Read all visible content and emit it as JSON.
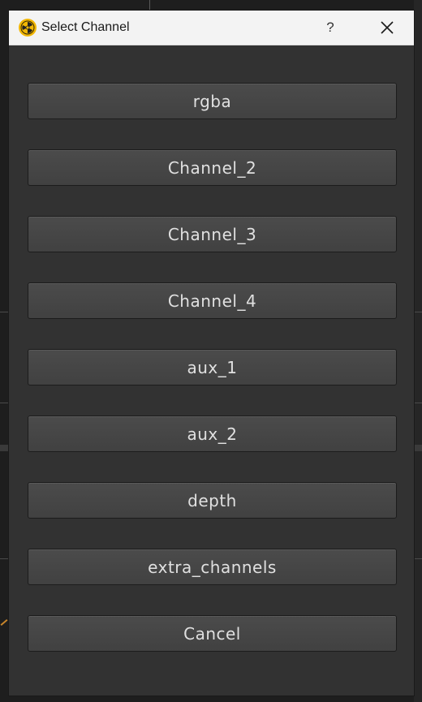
{
  "window": {
    "title": "Select Channel",
    "help_label": "?",
    "close_icon": "close-icon",
    "app_icon": "nuke-app-icon"
  },
  "buttons": [
    {
      "label": "rgba"
    },
    {
      "label": "Channel_2"
    },
    {
      "label": "Channel_3"
    },
    {
      "label": "Channel_4"
    },
    {
      "label": "aux_1"
    },
    {
      "label": "aux_2"
    },
    {
      "label": "depth"
    },
    {
      "label": "extra_channels"
    },
    {
      "label": "Cancel"
    }
  ],
  "colors": {
    "dialog_bg": "#323232",
    "button_bg": "#464646",
    "button_text": "#e0e0e0",
    "titlebar_bg": "#f3f3f3",
    "app_icon": "#f2b705"
  }
}
